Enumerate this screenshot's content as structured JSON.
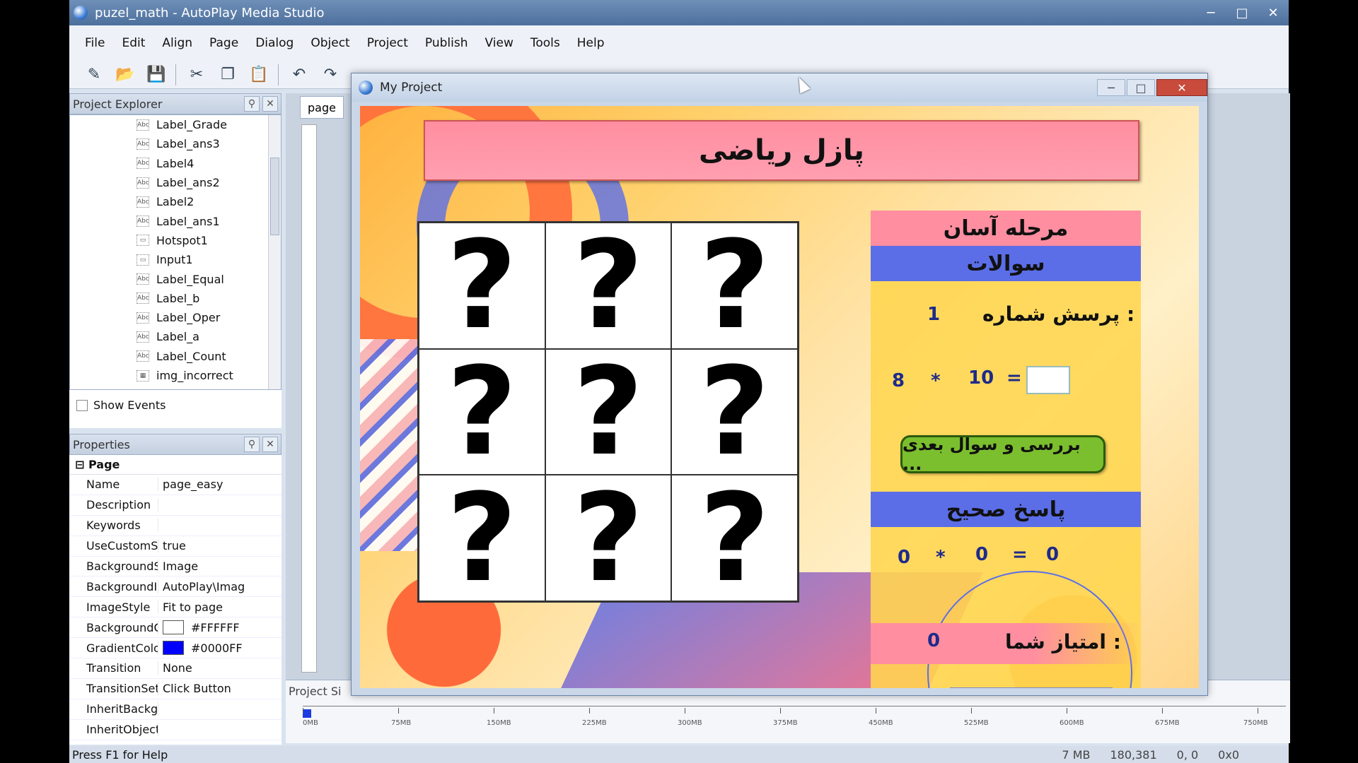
{
  "app": {
    "title": "puzel_math - AutoPlay Media Studio",
    "window_buttons": [
      "─",
      "□",
      "✕"
    ]
  },
  "menu": [
    "File",
    "Edit",
    "Align",
    "Page",
    "Dialog",
    "Object",
    "Project",
    "Publish",
    "View",
    "Tools",
    "Help"
  ],
  "explorer": {
    "title": "Project Explorer",
    "items": [
      {
        "icon": "Abc",
        "label": "Label_Grade"
      },
      {
        "icon": "Abc",
        "label": "Label_ans3"
      },
      {
        "icon": "Abc",
        "label": "Label4"
      },
      {
        "icon": "Abc",
        "label": "Label_ans2"
      },
      {
        "icon": "Abc",
        "label": "Label2"
      },
      {
        "icon": "Abc",
        "label": "Label_ans1"
      },
      {
        "icon": "▭",
        "label": "Hotspot1"
      },
      {
        "icon": "▭",
        "label": "Input1"
      },
      {
        "icon": "Abc",
        "label": "Label_Equal"
      },
      {
        "icon": "Abc",
        "label": "Label_b"
      },
      {
        "icon": "Abc",
        "label": "Label_Oper"
      },
      {
        "icon": "Abc",
        "label": "Label_a"
      },
      {
        "icon": "Abc",
        "label": "Label_Count"
      },
      {
        "icon": "▦",
        "label": "img_incorrect"
      }
    ],
    "show_events": "Show Events"
  },
  "properties": {
    "title": "Properties",
    "section": "Page",
    "rows": [
      {
        "key": "Name",
        "value": "page_easy"
      },
      {
        "key": "Description",
        "value": ""
      },
      {
        "key": "Keywords",
        "value": ""
      },
      {
        "key": "UseCustomSett",
        "value": "true"
      },
      {
        "key": "BackgroundStyl",
        "value": "Image"
      },
      {
        "key": "BackgroundIma",
        "value": "AutoPlay\\Imag"
      },
      {
        "key": "ImageStyle",
        "value": "Fit to page"
      },
      {
        "key": "BackgroundCol",
        "value": "#FFFFFF",
        "swatch": "#FFFFFF"
      },
      {
        "key": "GradientColor",
        "value": "#0000FF",
        "swatch": "#0000FF"
      },
      {
        "key": "Transition",
        "value": "None"
      },
      {
        "key": "TransitionSettin",
        "value": "Click Button"
      },
      {
        "key": "InheritBackgrou",
        "value": ""
      },
      {
        "key": "InheritObjects",
        "value": ""
      }
    ]
  },
  "editor": {
    "page_tab": "page"
  },
  "project_size": {
    "title": "Project Si",
    "marks": [
      "0MB",
      "75MB",
      "150MB",
      "225MB",
      "300MB",
      "375MB",
      "450MB",
      "525MB",
      "600MB",
      "675MB",
      "750MB"
    ]
  },
  "status": {
    "help": "Press F1 for Help",
    "memory": "7 MB",
    "coords": "180,381",
    "pos": "0, 0",
    "size": "0x0"
  },
  "dialog": {
    "title": "My Project",
    "buttons": [
      "─",
      "□",
      "✕"
    ]
  },
  "game": {
    "title": "پازل ریاضی",
    "cell_mark": "?",
    "stage": "مرحله آسان",
    "questions": "سوالات",
    "question_number_label": "پرسش شماره :",
    "question_number": "1",
    "operand_a": "8",
    "operator": "*",
    "operand_b": "10",
    "equals": "=",
    "check_button": "بررسی و سوال بعدی ...",
    "correct_answer_label": "پاسخ صحیح",
    "answer_a": "0",
    "answer_op": "*",
    "answer_b": "0",
    "answer_eq": "=",
    "answer_result": "0",
    "score_label": "امتیاز شما :",
    "score": "0"
  },
  "colors": {
    "title_pink": "#ff8ea0",
    "band_blue": "#5b6ee8",
    "side_yellow": "#ffd650",
    "button_green": "#7bbf2e"
  }
}
